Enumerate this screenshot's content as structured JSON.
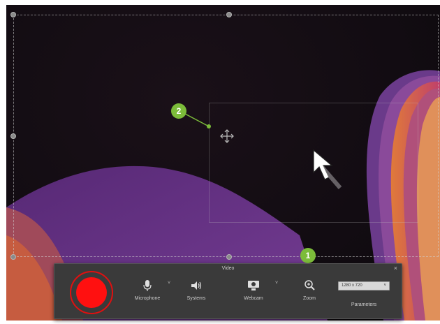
{
  "toolbar": {
    "title": "Video",
    "close_glyph": "×",
    "items": [
      {
        "label": "Microphone",
        "icon": "microphone-icon"
      },
      {
        "label": "Systems",
        "icon": "speaker-icon"
      },
      {
        "label": "Webcam",
        "icon": "webcam-icon"
      },
      {
        "label": "Zoom",
        "icon": "zoom-icon"
      }
    ],
    "resolution": "1280 x 720",
    "preset_label": "Parameters",
    "record_color": "#ff1010"
  },
  "callouts": [
    "1",
    "2"
  ],
  "colors": {
    "callout_green": "#7cbc3a",
    "toolbar_bg": "#3a3a3a"
  }
}
